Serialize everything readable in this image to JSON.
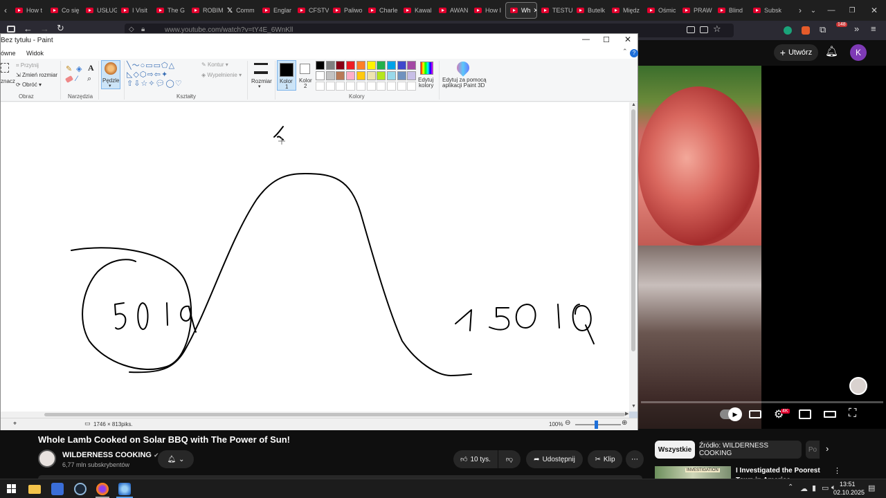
{
  "browser": {
    "tabs": [
      {
        "label": "How t",
        "icon": "youtube"
      },
      {
        "label": "Co się",
        "icon": "youtube"
      },
      {
        "label": "USŁUG",
        "icon": "youtube"
      },
      {
        "label": "I Visit",
        "icon": "youtube"
      },
      {
        "label": "The G",
        "icon": "youtube"
      },
      {
        "label": "ROBIM",
        "icon": "youtube"
      },
      {
        "label": "Comm",
        "icon": "x"
      },
      {
        "label": "Englar",
        "icon": "youtube"
      },
      {
        "label": "CFSTV",
        "icon": "youtube"
      },
      {
        "label": "Paliwo",
        "icon": "youtube"
      },
      {
        "label": "Charle",
        "icon": "youtube"
      },
      {
        "label": "Kawal",
        "icon": "youtube"
      },
      {
        "label": "AWAN",
        "icon": "youtube"
      },
      {
        "label": "How I",
        "icon": "youtube"
      },
      {
        "label": "Wh",
        "icon": "youtube",
        "active": true
      },
      {
        "label": "TESTU",
        "icon": "youtube"
      },
      {
        "label": "Butelk",
        "icon": "youtube"
      },
      {
        "label": "Międz",
        "icon": "youtube"
      },
      {
        "label": "Ośmic",
        "icon": "youtube"
      },
      {
        "label": "PRAW",
        "icon": "youtube"
      },
      {
        "label": "Blind",
        "icon": "youtube"
      },
      {
        "label": "Subsk",
        "icon": "youtube"
      }
    ],
    "url": "www.youtube.com/watch?v=tY4E_6WnKll",
    "notif_count": "148"
  },
  "paint": {
    "title": "Bez tytułu - Paint",
    "menu": [
      "ówne",
      "Widok"
    ],
    "ribbon": {
      "image_group": {
        "label": "Obraz",
        "crop": "Przytnij",
        "resize": "Zmień rozmiar",
        "rotate": "Obróć",
        "select": "znacz"
      },
      "tools_group": {
        "label": "Narzędzia"
      },
      "brushes": "Pędzle",
      "shapes_group": {
        "label": "Kształty",
        "outline": "Kontur",
        "fill": "Wypełnienie"
      },
      "size": "Rozmiar",
      "color1": "Kolor\n1",
      "color1_a": "Kolor",
      "color1_b": "1",
      "color2_a": "Kolor",
      "color2_b": "2",
      "colors_group": {
        "label": "Kolory"
      },
      "edit_colors_a": "Edytuj",
      "edit_colors_b": "kolory",
      "paint3d_a": "Edytuj za pomocą",
      "paint3d_b": "aplikacji Paint 3D"
    },
    "palette_row1": [
      "#000000",
      "#7f7f7f",
      "#880015",
      "#ed1c24",
      "#ff7f27",
      "#fff200",
      "#22b14c",
      "#00a2e8",
      "#3f48cc",
      "#a349a4"
    ],
    "palette_row2": [
      "#ffffff",
      "#c3c3c3",
      "#b97a57",
      "#ffaec9",
      "#ffc90e",
      "#efe4b0",
      "#b5e61d",
      "#99d9ea",
      "#7092be",
      "#c8bfe7"
    ],
    "drawing_text": {
      "left": "50 1 a",
      "right": "1 5 0 1 Q"
    },
    "status": {
      "dimensions": "1746 × 813piks.",
      "zoom": "100%"
    }
  },
  "youtube": {
    "create_label": "Utwórz",
    "avatar_letter": "K",
    "video_title": "Whole Lamb Cooked on Solar BBQ with The Power of Sun!",
    "channel_name": "WILDERNESS COOKING",
    "subscribers": "6,77 mln subskrybentów",
    "likes": "10 tys.",
    "share_label": "Udostępnij",
    "clip_label": "Klip",
    "chips": [
      "Wszystkie",
      "Źródło: WILDERNESS COOKING",
      "Po"
    ],
    "related_title": "I Investigated the Poorest Town in America",
    "related_badge": "INVESTIGATION",
    "quality_badge": "4K"
  },
  "taskbar": {
    "time": "13:51",
    "date": "02.10.2025"
  },
  "colors": {
    "accent_red": "#e1002d",
    "paint_blue": "#1e6fd9",
    "yt_bg": "#0f0f0f"
  }
}
